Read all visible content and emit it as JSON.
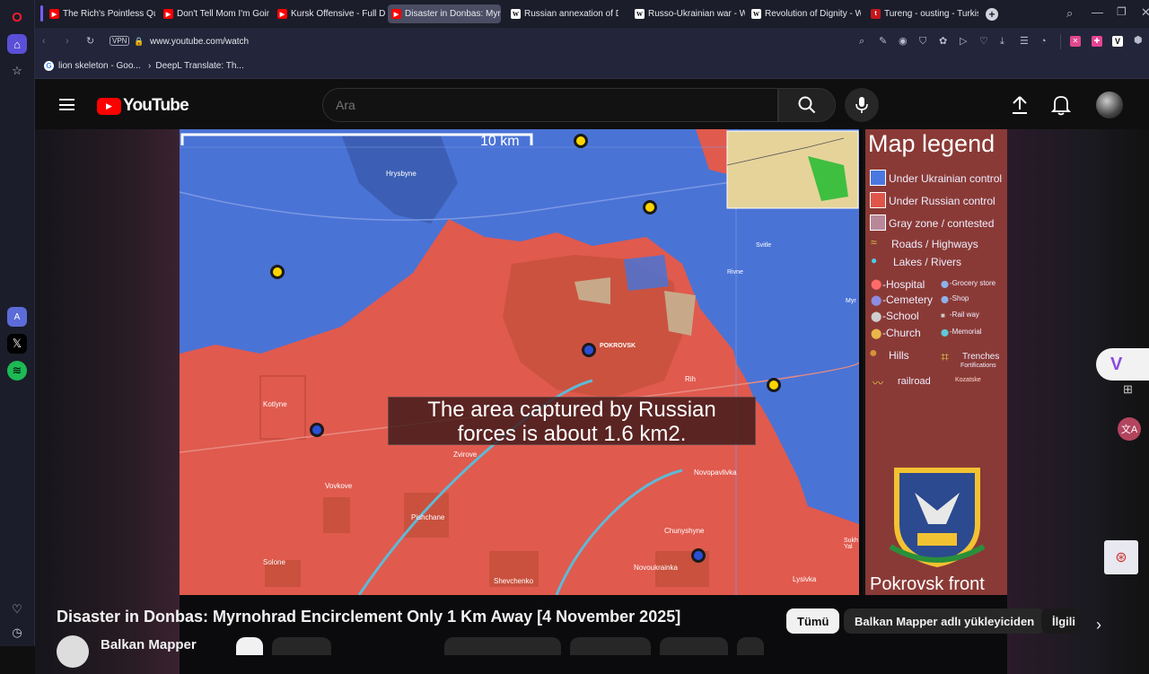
{
  "browser": {
    "tabs": [
      {
        "title": "The Rich's Pointless Quest",
        "icon": "youtube-favicon"
      },
      {
        "title": "Don't Tell Mom I'm Going",
        "icon": "youtube-favicon"
      },
      {
        "title": "Kursk Offensive - Full Doc",
        "icon": "youtube-favicon"
      },
      {
        "title": "Disaster in Donbas: Myrno",
        "icon": "youtube-favicon",
        "active": true
      },
      {
        "title": "Russian annexation of Don",
        "icon": "wikipedia-favicon"
      },
      {
        "title": "Russo-Ukrainian war - Wiki",
        "icon": "wikipedia-favicon"
      },
      {
        "title": "Revolution of Dignity - Wi",
        "icon": "wikipedia-favicon"
      },
      {
        "title": "Tureng - ousting - Turkish",
        "icon": "tureng-favicon"
      }
    ],
    "vpn_label": "VPN",
    "url": "www.youtube.com/watch",
    "bookmarks": [
      {
        "label": "lion skeleton - Goo..."
      },
      {
        "label": "DeepL Translate: Th..."
      }
    ]
  },
  "youtube": {
    "logo_text": "YouTube",
    "search_placeholder": "Ara",
    "video_title": "Disaster in Donbas: Myrnohrad Encirclement Only 1 Km Away [4 November 2025]",
    "channel_name": "Balkan Mapper",
    "chips": [
      "Tümü",
      "Balkan Mapper adlı yükleyiciden",
      "İlgili"
    ]
  },
  "video_frame": {
    "scale_label": "10 km",
    "caption_line1": "The area captured by Russian",
    "caption_line2": "forces is about 1.6 km2.",
    "legend": {
      "title": "Map legend",
      "items": [
        {
          "label": "Under Ukrainian control",
          "color": "#4a78e0"
        },
        {
          "label": "Under Russian control",
          "color": "#e0554a"
        },
        {
          "label": "Gray zone / contested",
          "color": "#b8889a"
        }
      ],
      "lines": [
        "Roads / Highways",
        "Lakes / Rivers"
      ],
      "poi_left": [
        "-Hospital",
        "-Cemetery",
        "-School",
        "-Church"
      ],
      "poi_right": [
        "-Grocery store",
        "-Shop",
        "-Rail way",
        "-Memorial"
      ],
      "hills": "Hills",
      "trenches": "Trenches",
      "fortifications": "Fortifications",
      "railroad": "railroad",
      "front_label": "Pokrovsk front"
    },
    "places": [
      "Hrysbyne",
      "POKROVSK",
      "Kotlyne",
      "Zvirove",
      "Vovkove",
      "Pishchane",
      "Solone",
      "Shevchenko",
      "Novopavlivka",
      "Chunyshyne",
      "Novoukrainka",
      "Lysivka",
      "Rih",
      "Svitle",
      "Rivne",
      "Myr",
      "Kozatske",
      "Sukh Yal"
    ],
    "colors": {
      "ukraine": "#4a73d6",
      "russia": "#e05a4e",
      "contested": "#c7a98a"
    }
  }
}
